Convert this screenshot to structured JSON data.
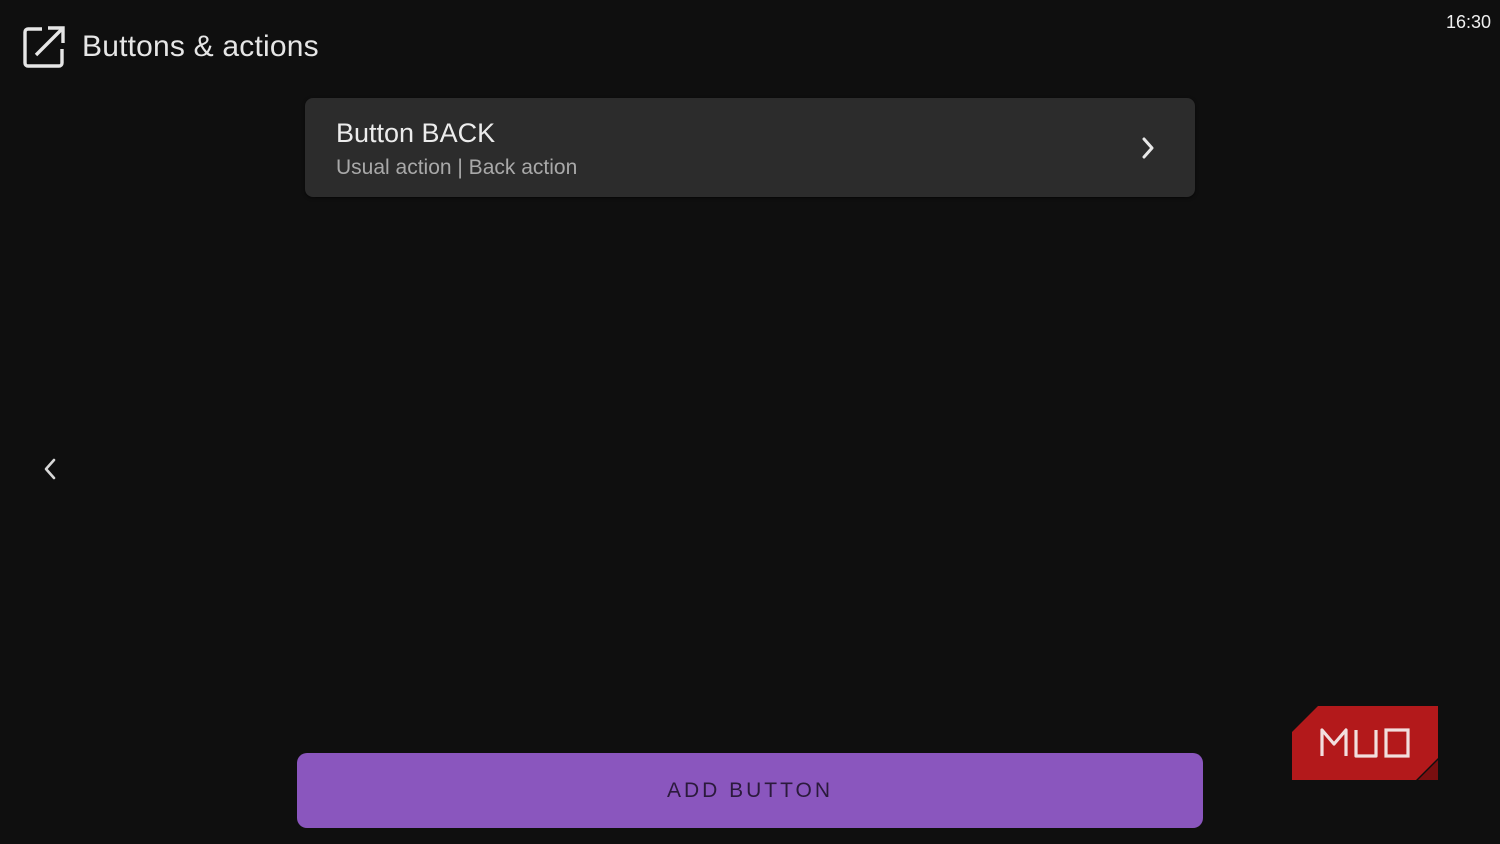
{
  "header": {
    "icon": "edit-external-icon",
    "title": "Buttons & actions"
  },
  "status_bar": {
    "time": "16:30"
  },
  "list": {
    "items": [
      {
        "title": "Button BACK",
        "subtitle": "Usual action | Back action",
        "trailing_icon": "chevron-right-icon"
      }
    ]
  },
  "navigation": {
    "back_icon": "chevron-left-icon"
  },
  "footer": {
    "add_button_label": "ADD BUTTON",
    "add_button_color": "#8a56be"
  },
  "watermark": {
    "text": "MUO",
    "color": "#b3191b"
  }
}
